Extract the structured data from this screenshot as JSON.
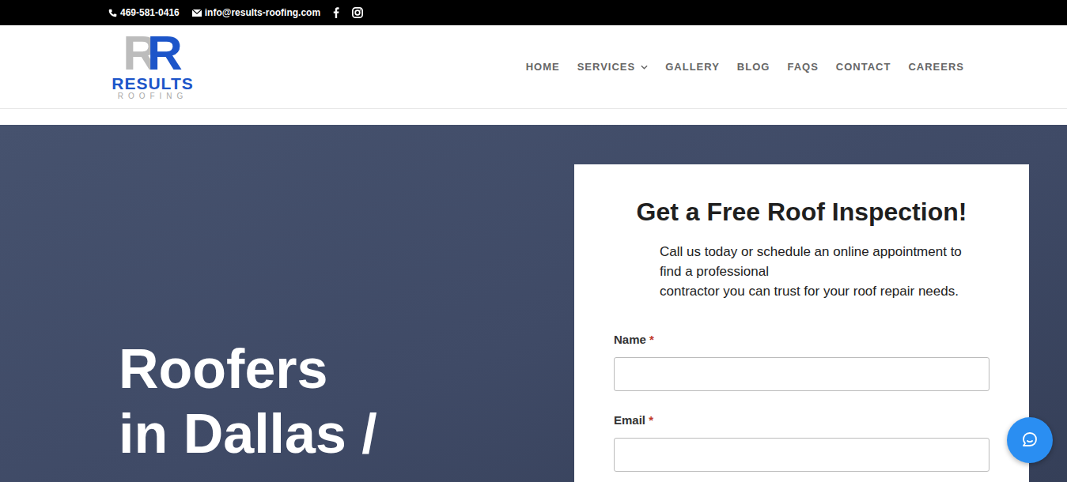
{
  "topbar": {
    "phone": "469-581-0416",
    "email": "info@results-roofing.com"
  },
  "logo": {
    "mark": [
      "R",
      "R"
    ],
    "name": "RESULTS",
    "tagline": "ROOFING"
  },
  "nav": [
    {
      "label": "HOME",
      "selected": false,
      "has_menu": false
    },
    {
      "label": "SERVICES",
      "selected": false,
      "has_menu": true
    },
    {
      "label": "GALLERY",
      "selected": false,
      "has_menu": false
    },
    {
      "label": "BLOG",
      "selected": false,
      "has_menu": false
    },
    {
      "label": "FAQS",
      "selected": false,
      "has_menu": false
    },
    {
      "label": "CONTACT",
      "selected": false,
      "has_menu": false
    },
    {
      "label": "CAREERS",
      "selected": false,
      "has_menu": false
    }
  ],
  "hero": {
    "title_lines": [
      "Roofers",
      "in Dallas /"
    ]
  },
  "form": {
    "title": "Get a Free Roof Inspection!",
    "intro_lines": [
      "Call us today or schedule an online appointment to",
      "find a professional",
      "contractor you can trust for your roof repair needs."
    ],
    "fields": [
      {
        "label": "Name",
        "marker": "*",
        "required": true,
        "value": ""
      },
      {
        "label": "Email",
        "marker": "*",
        "required": true,
        "value": ""
      }
    ]
  }
}
